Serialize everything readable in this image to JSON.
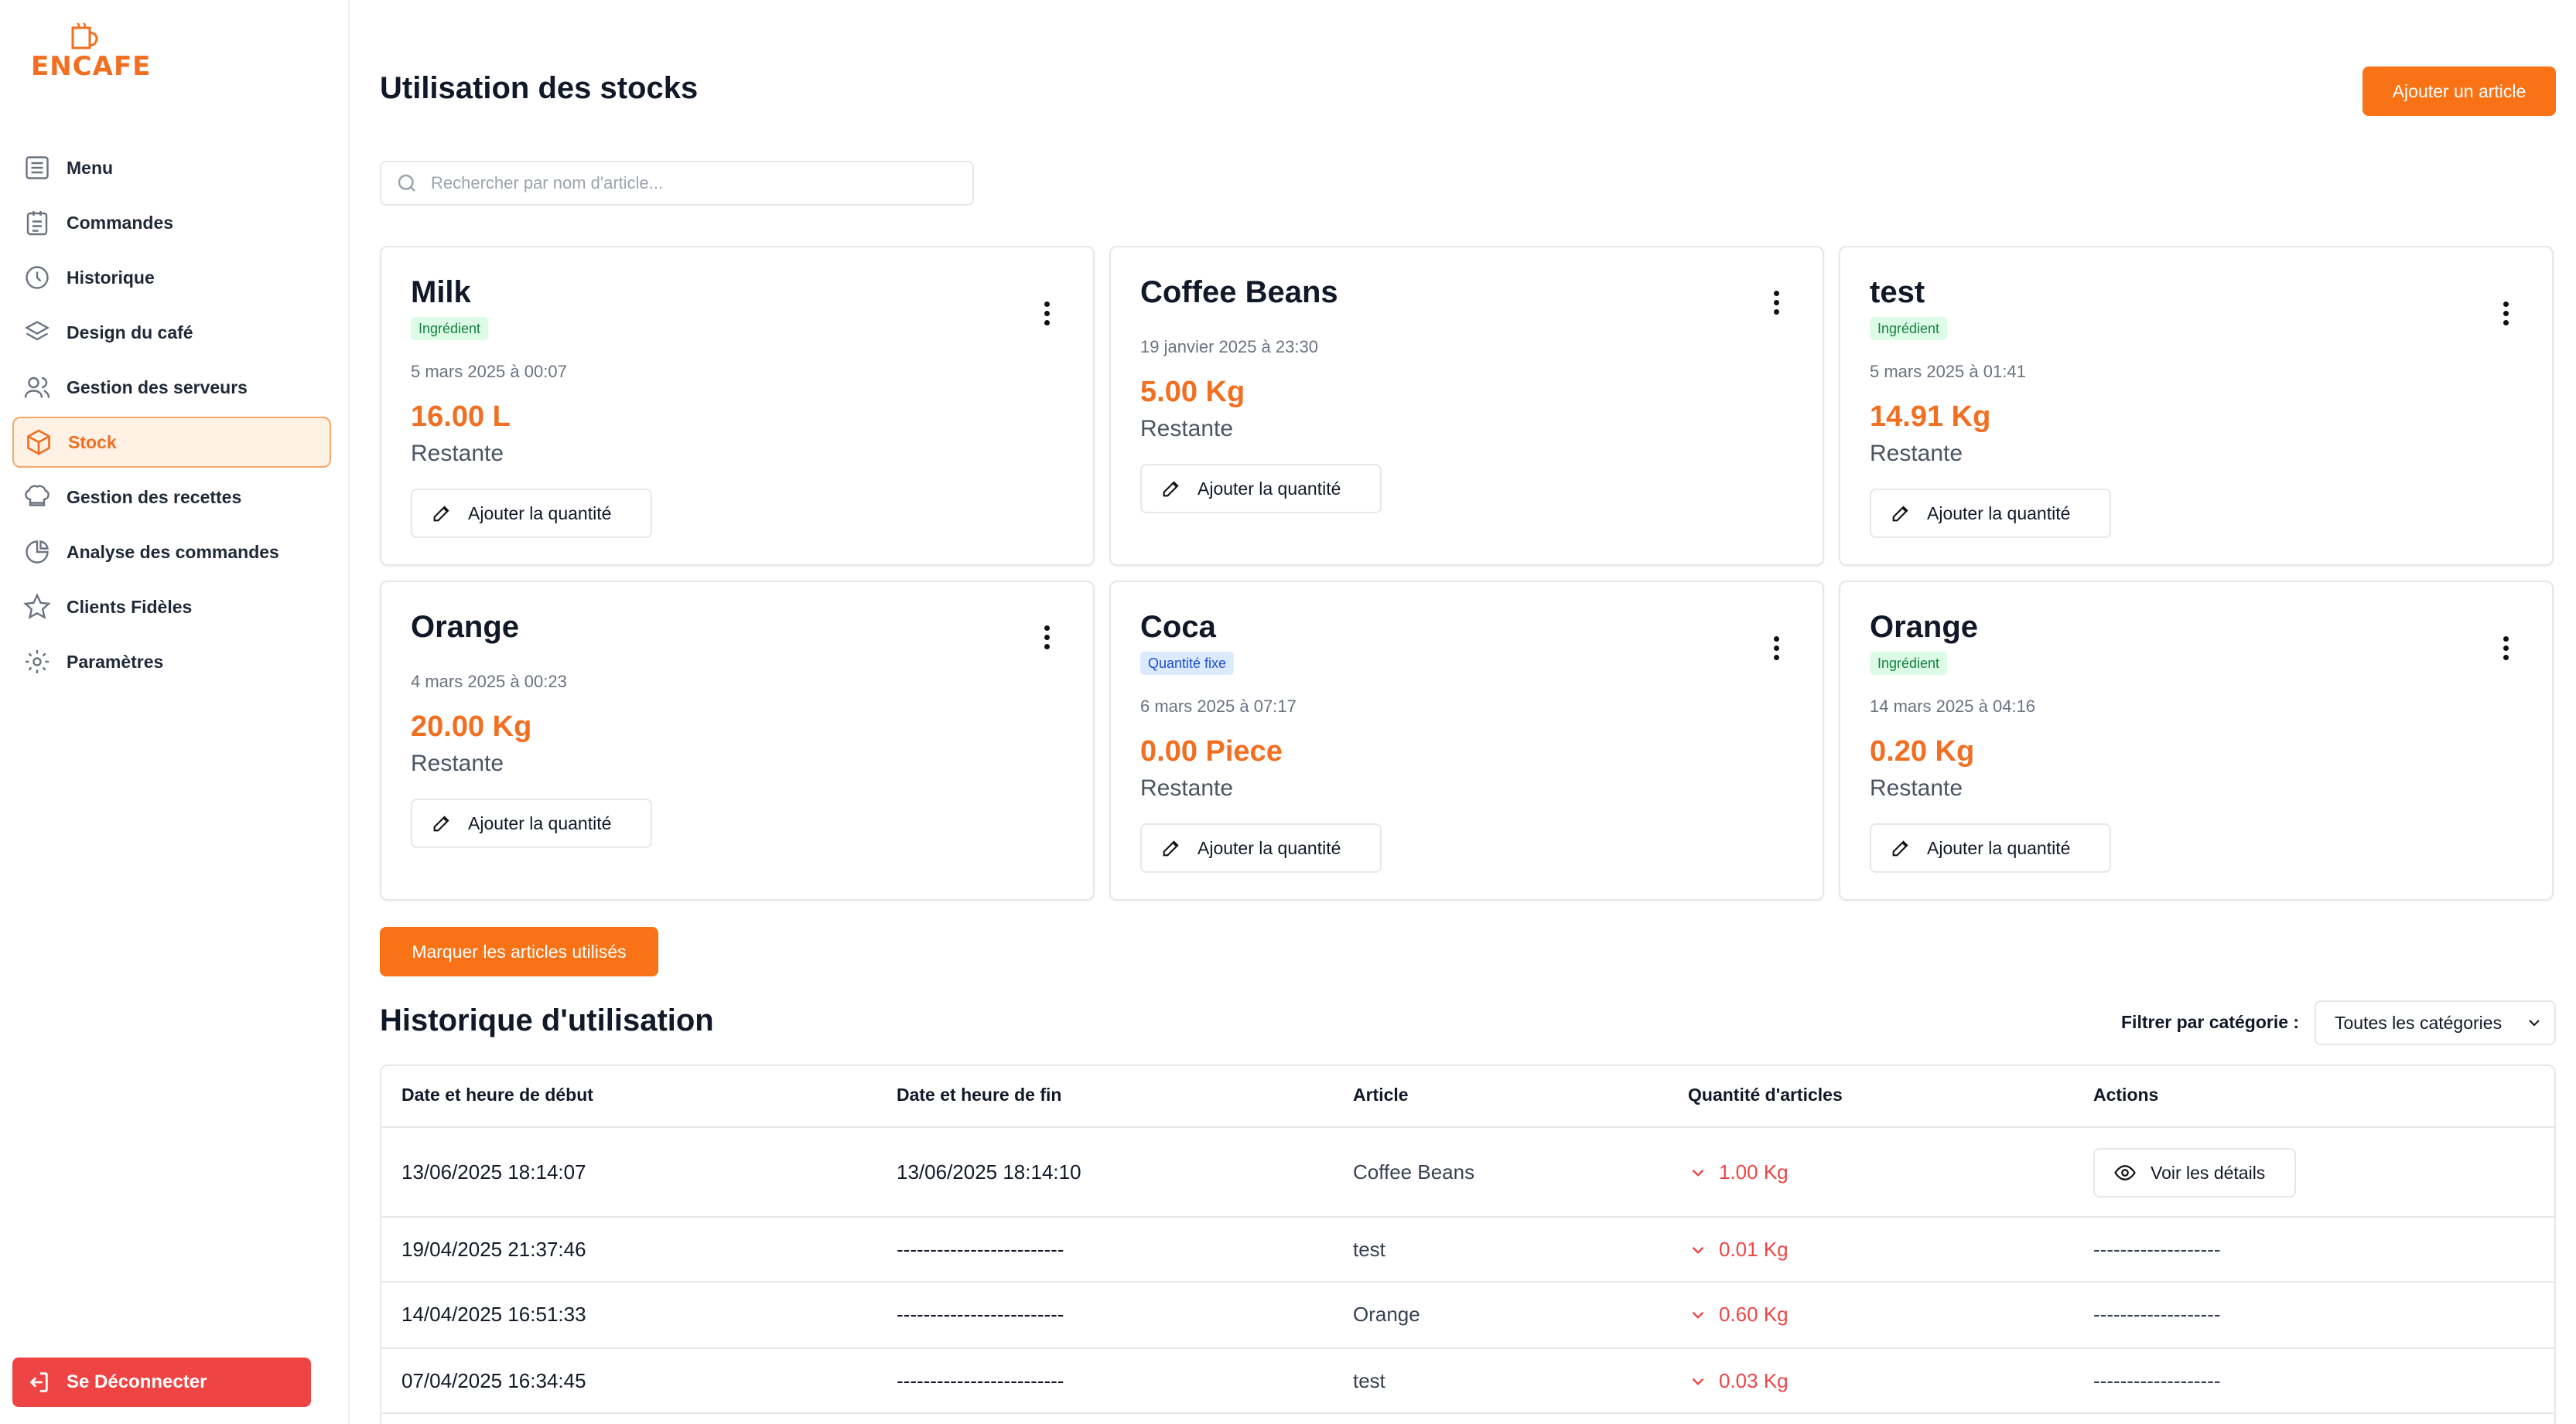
{
  "brand": {
    "logo_text": "ENCAFE",
    "accent": "#f26f21"
  },
  "sidebar": {
    "items": [
      {
        "label": "Menu",
        "icon": "list-icon",
        "active": false
      },
      {
        "label": "Commandes",
        "icon": "clipboard-icon",
        "active": false
      },
      {
        "label": "Historique",
        "icon": "clock-icon",
        "active": false
      },
      {
        "label": "Design du café",
        "icon": "layers-icon",
        "active": false
      },
      {
        "label": "Gestion des serveurs",
        "icon": "users-icon",
        "active": false
      },
      {
        "label": "Stock",
        "icon": "box-icon",
        "active": true
      },
      {
        "label": "Gestion des recettes",
        "icon": "chef-hat-icon",
        "active": false
      },
      {
        "label": "Analyse des commandes",
        "icon": "pie-chart-icon",
        "active": false
      },
      {
        "label": "Clients Fidèles",
        "icon": "star-icon",
        "active": false
      },
      {
        "label": "Paramètres",
        "icon": "gear-icon",
        "active": false
      }
    ],
    "logout_label": "Se Déconnecter"
  },
  "header": {
    "title": "Utilisation des stocks",
    "add_button": "Ajouter un article"
  },
  "search": {
    "placeholder": "Rechercher par nom d'article..."
  },
  "cards": [
    {
      "name": "Milk",
      "badge": "Ingrédient",
      "badge_type": "green",
      "date": "5 mars 2025 à 00:07",
      "quantity": "16.00 L",
      "remaining": "Restante",
      "action": "Ajouter la quantité"
    },
    {
      "name": "Coffee Beans",
      "badge": "",
      "badge_type": "",
      "date": "19 janvier 2025 à 23:30",
      "quantity": "5.00 Kg",
      "remaining": "Restante",
      "action": "Ajouter la quantité"
    },
    {
      "name": "test",
      "badge": "Ingrédient",
      "badge_type": "green",
      "date": "5 mars 2025 à 01:41",
      "quantity": "14.91 Kg",
      "remaining": "Restante",
      "action": "Ajouter la quantité"
    },
    {
      "name": "Orange",
      "badge": "",
      "badge_type": "",
      "date": "4 mars 2025 à 00:23",
      "quantity": "20.00 Kg",
      "remaining": "Restante",
      "action": "Ajouter la quantité"
    },
    {
      "name": "Coca",
      "badge": "Quantité fixe",
      "badge_type": "blue",
      "date": "6 mars 2025 à 07:17",
      "quantity": "0.00 Piece",
      "remaining": "Restante",
      "action": "Ajouter la quantité"
    },
    {
      "name": "Orange",
      "badge": "Ingrédient",
      "badge_type": "green",
      "date": "14 mars 2025 à 04:16",
      "quantity": "0.20 Kg",
      "remaining": "Restante",
      "action": "Ajouter la quantité"
    }
  ],
  "mark_used_button": "Marquer les articles utilisés",
  "history": {
    "title": "Historique d'utilisation",
    "filter_label": "Filtrer par catégorie :",
    "filter_value": "Toutes les catégories",
    "columns": [
      "Date et heure de début",
      "Date et heure de fin",
      "Article",
      "Quantité d'articles",
      "Actions"
    ],
    "rows": [
      {
        "start": "13/06/2025 18:14:07",
        "end": "13/06/2025 18:14:10",
        "article": "Coffee Beans",
        "qty": "1.00 Kg",
        "action": "Voir les détails"
      },
      {
        "start": "19/04/2025 21:37:46",
        "end": "-------------------------",
        "article": "test",
        "qty": "0.01 Kg",
        "action": "-------------------"
      },
      {
        "start": "14/04/2025 16:51:33",
        "end": "-------------------------",
        "article": "Orange",
        "qty": "0.60 Kg",
        "action": "-------------------"
      },
      {
        "start": "07/04/2025 16:34:45",
        "end": "-------------------------",
        "article": "test",
        "qty": "0.03 Kg",
        "action": "-------------------"
      }
    ]
  }
}
